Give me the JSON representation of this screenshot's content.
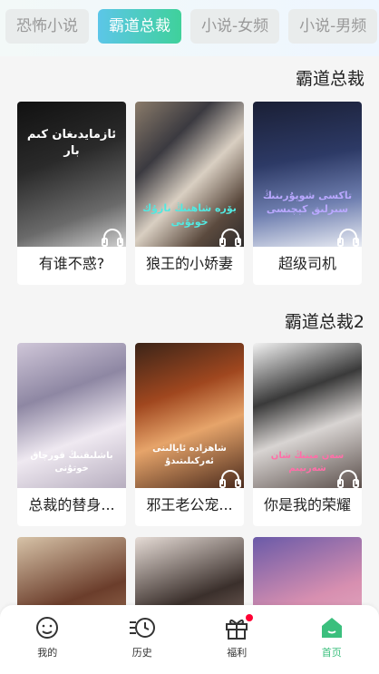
{
  "tabs": [
    {
      "label": "恐怖小说",
      "active": false
    },
    {
      "label": "霸道总裁",
      "active": true
    },
    {
      "label": "小说-女频",
      "active": false
    },
    {
      "label": "小说-男频",
      "active": false
    }
  ],
  "sections": [
    {
      "title": "霸道总裁",
      "books": [
        {
          "title": "有谁不惑?",
          "cover_text": "ئازمايدىغان كىم بار"
        },
        {
          "title": "狼王的小娇妻",
          "cover_text": "بۆرە شاھنىڭ نازۇك خوتۇنى"
        },
        {
          "title": "超级司机",
          "cover_text": "تاكسى شوپۇرىنىڭ سىرلىق كېچىسى"
        }
      ]
    },
    {
      "title": "霸道总裁2",
      "books": [
        {
          "title": "总裁的替身...",
          "cover_text": "باشلىقنىڭ قورچاق خوتۇنى"
        },
        {
          "title": "邪王老公宠...",
          "cover_text": "شاھزادە ئايالىنى ئەركىلىتىدۇ"
        },
        {
          "title": "你是我的荣耀",
          "cover_text": "سەن مېنىڭ شان شەرىپىم"
        }
      ]
    }
  ],
  "nav": [
    {
      "label": "我的",
      "icon": "face-icon"
    },
    {
      "label": "历史",
      "icon": "history-icon"
    },
    {
      "label": "福利",
      "icon": "gift-icon",
      "badge": true
    },
    {
      "label": "首页",
      "icon": "home-icon",
      "active": true
    }
  ],
  "colors": {
    "accent": "#3bbf7d",
    "tab_gradient_start": "#5cc6e8",
    "tab_gradient_end": "#3fd19b"
  }
}
